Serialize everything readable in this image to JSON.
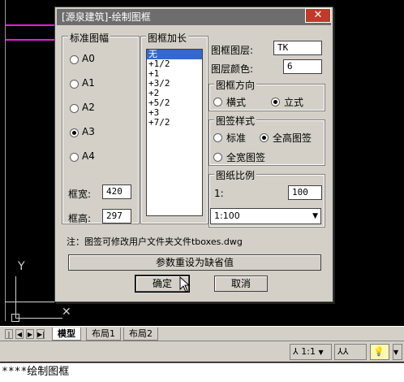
{
  "dialog": {
    "title": "[源泉建筑]-绘制图框",
    "close_icon": "close-icon",
    "paper_group": {
      "title": "标准图幅",
      "options": [
        "A0",
        "A1",
        "A2",
        "A3",
        "A4"
      ],
      "selected": "A3",
      "width_label": "框宽:",
      "width_value": "420",
      "height_label": "框高:",
      "height_value": "297"
    },
    "extend_group": {
      "title": "图框加长",
      "items": [
        "无",
        "+1/2",
        "+1",
        "+3/2",
        "+2",
        "+5/2",
        "+3",
        "+7/2"
      ],
      "selected": "无"
    },
    "layer_label": "图框图层:",
    "layer_value": "TK",
    "color_label": "图层颜色:",
    "color_value": "6",
    "orientation_group": {
      "title": "图框方向",
      "options": [
        "横式",
        "立式"
      ],
      "selected": "立式"
    },
    "sign_group": {
      "title": "图签样式",
      "options": [
        "标准",
        "全高图签",
        "全宽图签"
      ],
      "selected": "全高图签"
    },
    "scale_group": {
      "title": "图纸比例",
      "ratio_label": "1:",
      "ratio_value": "100",
      "select_value": "1:100"
    },
    "note": "注：图签可修改用户文件夹文件tboxes.dwg",
    "reset_button": "参数重设为缺省值",
    "ok_button": "确定",
    "cancel_button": "取消"
  },
  "tabs": [
    "模型",
    "布局1",
    "布局2"
  ],
  "statusbar": {
    "scale": "1:1",
    "annotation_icon": "annotation-scale-icon",
    "bulb_icon": "lightbulb-icon"
  },
  "command_line": "****绘制图框",
  "colors": {
    "canvas": "#000000",
    "magenta": "#e020e0",
    "dialog_bg": "#d4d0c8",
    "title_bar": "#6d6d6d",
    "close_button": "#c0392b",
    "selection": "#3368d0"
  }
}
